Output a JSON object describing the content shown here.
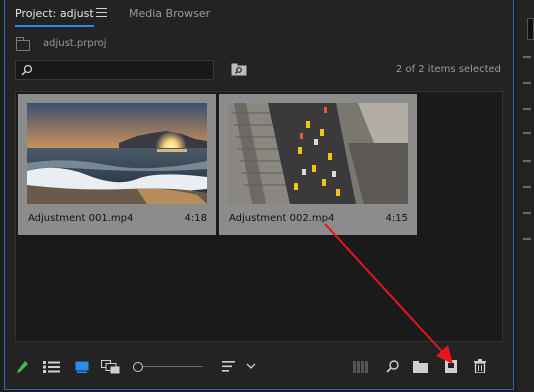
{
  "tabs": {
    "active_label": "Project: adjust",
    "media_label": "Media Browser"
  },
  "project": {
    "file_name": "adjust.prproj",
    "items_status": "2 of 2 items selected"
  },
  "search": {
    "value": "",
    "placeholder": ""
  },
  "items": [
    {
      "name": "Adjustment 001.mp4",
      "duration": "4:18",
      "thumbnail": "sunset-beach-waves"
    },
    {
      "name": "Adjustment 002.mp4",
      "duration": "4:15",
      "thumbnail": "aerial-city-street-taxis"
    }
  ],
  "bottom_toolbar": [
    "pencil-icon",
    "list-view-icon",
    "icon-view-icon",
    "freeform-view-icon",
    "zoom-slider",
    "sort-icon",
    "sort-dropdown-icon",
    "automate-to-sequence-icon",
    "find-icon",
    "new-bin-icon",
    "new-item-icon",
    "trash-icon"
  ],
  "zoom_level": 0,
  "colors": {
    "accent_blue": "#2d8ceb",
    "selection_gray": "#8c8c8c",
    "annotation_arrow": "#e8141c",
    "pencil_green": "#3cbf4a"
  },
  "annotation": {
    "type": "arrow",
    "target": "new-item-icon"
  }
}
